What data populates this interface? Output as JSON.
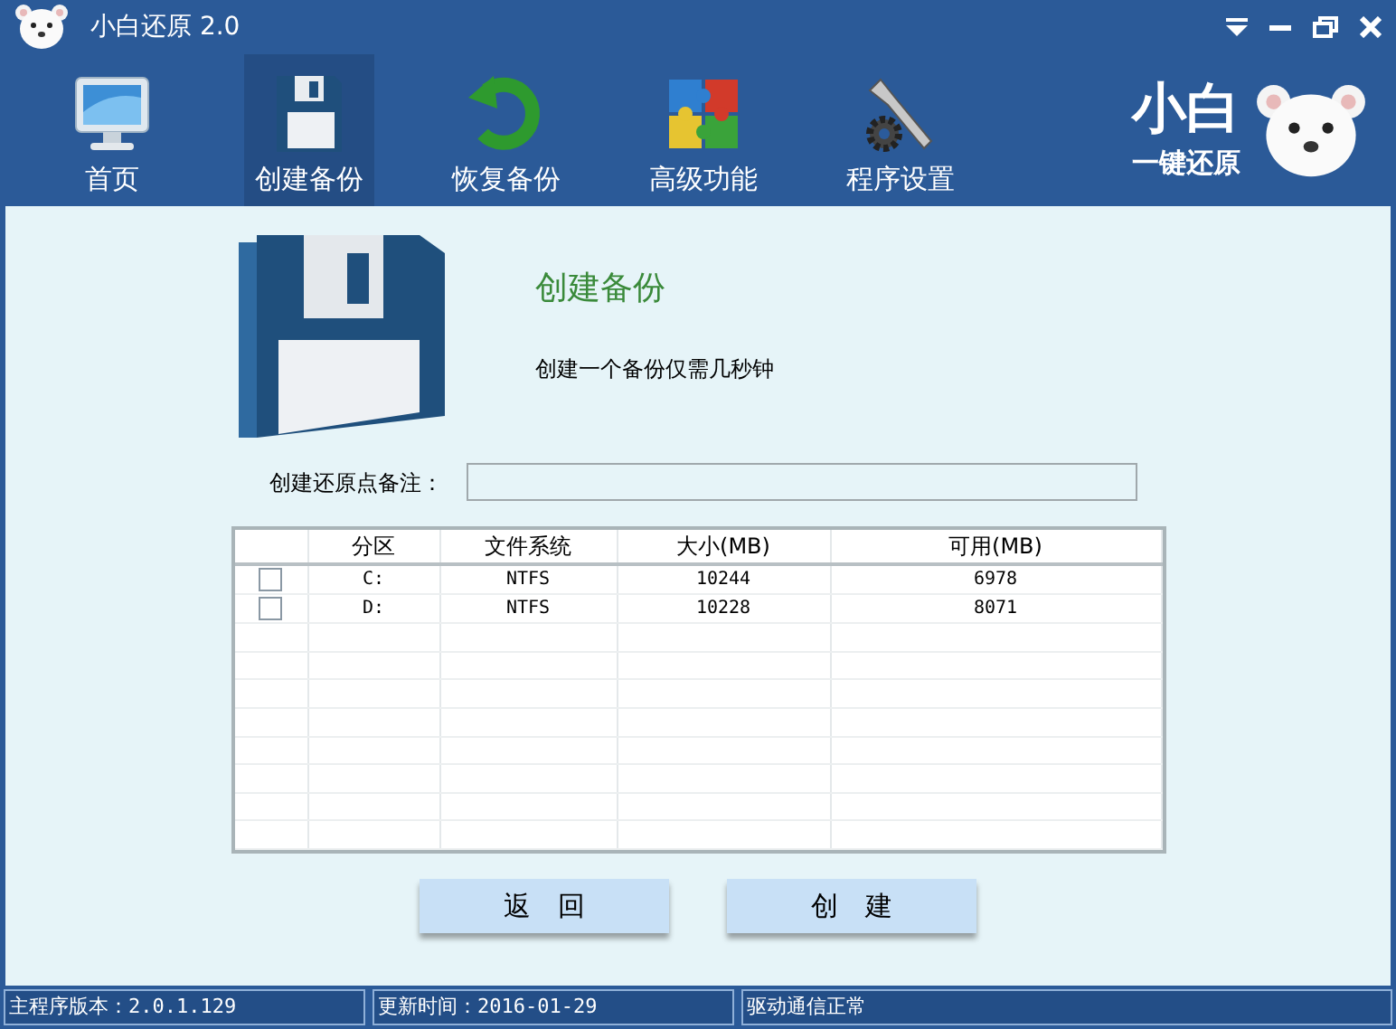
{
  "window": {
    "title": "小白还原 2.0"
  },
  "toolbar": [
    {
      "label": "首页",
      "kind": "monitor",
      "selected": false
    },
    {
      "label": "创建备份",
      "kind": "floppy",
      "selected": true
    },
    {
      "label": "恢复备份",
      "kind": "restore",
      "selected": false
    },
    {
      "label": "高级功能",
      "kind": "puzzle",
      "selected": false
    },
    {
      "label": "程序设置",
      "kind": "tools",
      "selected": false
    }
  ],
  "logo": {
    "title": "小白",
    "subtitle": "一键还原"
  },
  "heading": {
    "title": "创建备份",
    "description": "创建一个备份仅需几秒钟"
  },
  "note": {
    "label": "创建还原点备注："
  },
  "table": {
    "columns": [
      "分区",
      "文件系统",
      "大小(MB)",
      "可用(MB)"
    ],
    "rows": [
      {
        "checked": false,
        "cells": [
          "C:",
          "NTFS",
          "10244",
          "6978"
        ]
      },
      {
        "checked": false,
        "cells": [
          "D:",
          "NTFS",
          "10228",
          "8071"
        ]
      }
    ]
  },
  "buttons": [
    "返　回",
    "创　建"
  ],
  "status_bar": [
    "主程序版本：2.0.1.129",
    "更新时间：2016-01-29",
    "驱动通信正常"
  ]
}
